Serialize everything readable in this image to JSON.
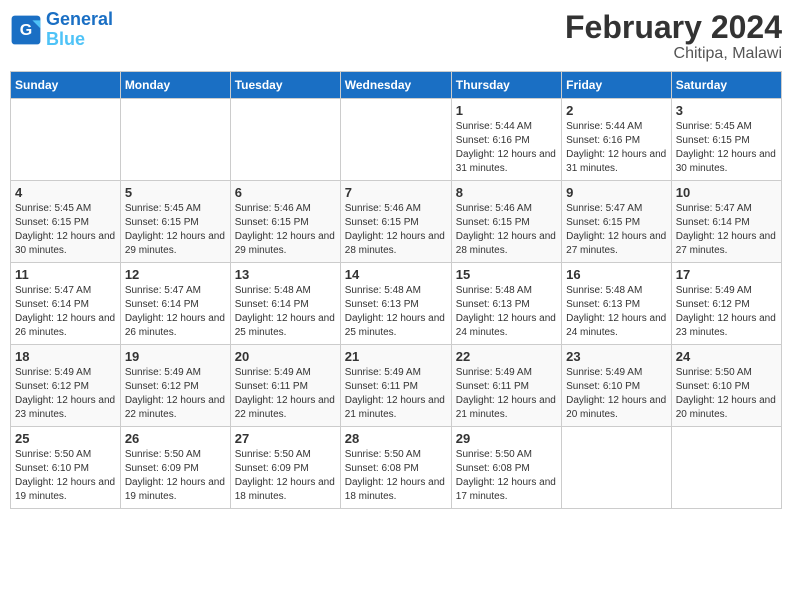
{
  "header": {
    "logo_line1": "General",
    "logo_line2": "Blue",
    "title": "February 2024",
    "subtitle": "Chitipa, Malawi"
  },
  "days_of_week": [
    "Sunday",
    "Monday",
    "Tuesday",
    "Wednesday",
    "Thursday",
    "Friday",
    "Saturday"
  ],
  "weeks": [
    [
      {
        "day": "",
        "sunrise": "",
        "sunset": "",
        "daylight": ""
      },
      {
        "day": "",
        "sunrise": "",
        "sunset": "",
        "daylight": ""
      },
      {
        "day": "",
        "sunrise": "",
        "sunset": "",
        "daylight": ""
      },
      {
        "day": "",
        "sunrise": "",
        "sunset": "",
        "daylight": ""
      },
      {
        "day": "1",
        "sunrise": "Sunrise: 5:44 AM",
        "sunset": "Sunset: 6:16 PM",
        "daylight": "Daylight: 12 hours and 31 minutes."
      },
      {
        "day": "2",
        "sunrise": "Sunrise: 5:44 AM",
        "sunset": "Sunset: 6:16 PM",
        "daylight": "Daylight: 12 hours and 31 minutes."
      },
      {
        "day": "3",
        "sunrise": "Sunrise: 5:45 AM",
        "sunset": "Sunset: 6:15 PM",
        "daylight": "Daylight: 12 hours and 30 minutes."
      }
    ],
    [
      {
        "day": "4",
        "sunrise": "Sunrise: 5:45 AM",
        "sunset": "Sunset: 6:15 PM",
        "daylight": "Daylight: 12 hours and 30 minutes."
      },
      {
        "day": "5",
        "sunrise": "Sunrise: 5:45 AM",
        "sunset": "Sunset: 6:15 PM",
        "daylight": "Daylight: 12 hours and 29 minutes."
      },
      {
        "day": "6",
        "sunrise": "Sunrise: 5:46 AM",
        "sunset": "Sunset: 6:15 PM",
        "daylight": "Daylight: 12 hours and 29 minutes."
      },
      {
        "day": "7",
        "sunrise": "Sunrise: 5:46 AM",
        "sunset": "Sunset: 6:15 PM",
        "daylight": "Daylight: 12 hours and 28 minutes."
      },
      {
        "day": "8",
        "sunrise": "Sunrise: 5:46 AM",
        "sunset": "Sunset: 6:15 PM",
        "daylight": "Daylight: 12 hours and 28 minutes."
      },
      {
        "day": "9",
        "sunrise": "Sunrise: 5:47 AM",
        "sunset": "Sunset: 6:15 PM",
        "daylight": "Daylight: 12 hours and 27 minutes."
      },
      {
        "day": "10",
        "sunrise": "Sunrise: 5:47 AM",
        "sunset": "Sunset: 6:14 PM",
        "daylight": "Daylight: 12 hours and 27 minutes."
      }
    ],
    [
      {
        "day": "11",
        "sunrise": "Sunrise: 5:47 AM",
        "sunset": "Sunset: 6:14 PM",
        "daylight": "Daylight: 12 hours and 26 minutes."
      },
      {
        "day": "12",
        "sunrise": "Sunrise: 5:47 AM",
        "sunset": "Sunset: 6:14 PM",
        "daylight": "Daylight: 12 hours and 26 minutes."
      },
      {
        "day": "13",
        "sunrise": "Sunrise: 5:48 AM",
        "sunset": "Sunset: 6:14 PM",
        "daylight": "Daylight: 12 hours and 25 minutes."
      },
      {
        "day": "14",
        "sunrise": "Sunrise: 5:48 AM",
        "sunset": "Sunset: 6:13 PM",
        "daylight": "Daylight: 12 hours and 25 minutes."
      },
      {
        "day": "15",
        "sunrise": "Sunrise: 5:48 AM",
        "sunset": "Sunset: 6:13 PM",
        "daylight": "Daylight: 12 hours and 24 minutes."
      },
      {
        "day": "16",
        "sunrise": "Sunrise: 5:48 AM",
        "sunset": "Sunset: 6:13 PM",
        "daylight": "Daylight: 12 hours and 24 minutes."
      },
      {
        "day": "17",
        "sunrise": "Sunrise: 5:49 AM",
        "sunset": "Sunset: 6:12 PM",
        "daylight": "Daylight: 12 hours and 23 minutes."
      }
    ],
    [
      {
        "day": "18",
        "sunrise": "Sunrise: 5:49 AM",
        "sunset": "Sunset: 6:12 PM",
        "daylight": "Daylight: 12 hours and 23 minutes."
      },
      {
        "day": "19",
        "sunrise": "Sunrise: 5:49 AM",
        "sunset": "Sunset: 6:12 PM",
        "daylight": "Daylight: 12 hours and 22 minutes."
      },
      {
        "day": "20",
        "sunrise": "Sunrise: 5:49 AM",
        "sunset": "Sunset: 6:11 PM",
        "daylight": "Daylight: 12 hours and 22 minutes."
      },
      {
        "day": "21",
        "sunrise": "Sunrise: 5:49 AM",
        "sunset": "Sunset: 6:11 PM",
        "daylight": "Daylight: 12 hours and 21 minutes."
      },
      {
        "day": "22",
        "sunrise": "Sunrise: 5:49 AM",
        "sunset": "Sunset: 6:11 PM",
        "daylight": "Daylight: 12 hours and 21 minutes."
      },
      {
        "day": "23",
        "sunrise": "Sunrise: 5:49 AM",
        "sunset": "Sunset: 6:10 PM",
        "daylight": "Daylight: 12 hours and 20 minutes."
      },
      {
        "day": "24",
        "sunrise": "Sunrise: 5:50 AM",
        "sunset": "Sunset: 6:10 PM",
        "daylight": "Daylight: 12 hours and 20 minutes."
      }
    ],
    [
      {
        "day": "25",
        "sunrise": "Sunrise: 5:50 AM",
        "sunset": "Sunset: 6:10 PM",
        "daylight": "Daylight: 12 hours and 19 minutes."
      },
      {
        "day": "26",
        "sunrise": "Sunrise: 5:50 AM",
        "sunset": "Sunset: 6:09 PM",
        "daylight": "Daylight: 12 hours and 19 minutes."
      },
      {
        "day": "27",
        "sunrise": "Sunrise: 5:50 AM",
        "sunset": "Sunset: 6:09 PM",
        "daylight": "Daylight: 12 hours and 18 minutes."
      },
      {
        "day": "28",
        "sunrise": "Sunrise: 5:50 AM",
        "sunset": "Sunset: 6:08 PM",
        "daylight": "Daylight: 12 hours and 18 minutes."
      },
      {
        "day": "29",
        "sunrise": "Sunrise: 5:50 AM",
        "sunset": "Sunset: 6:08 PM",
        "daylight": "Daylight: 12 hours and 17 minutes."
      },
      {
        "day": "",
        "sunrise": "",
        "sunset": "",
        "daylight": ""
      },
      {
        "day": "",
        "sunrise": "",
        "sunset": "",
        "daylight": ""
      }
    ]
  ]
}
